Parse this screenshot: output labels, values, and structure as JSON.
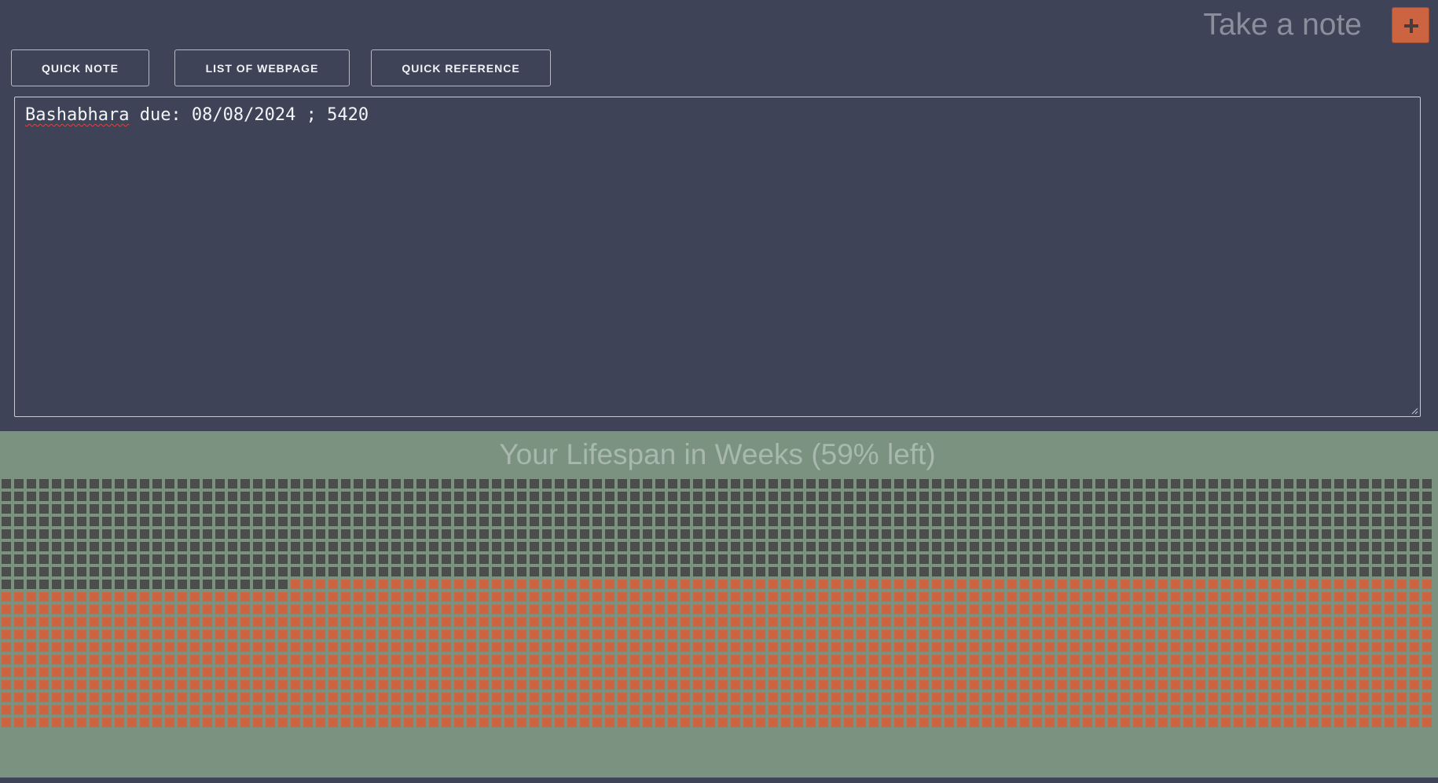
{
  "header": {
    "placeholder": "Take a note",
    "add_button_icon": "plus-icon"
  },
  "tabs": [
    {
      "label": "QUICK NOTE"
    },
    {
      "label": "LIST OF WEBPAGE"
    },
    {
      "label": "QUICK REFERENCE"
    }
  ],
  "note": {
    "misspelled_word": "Bashabhara",
    "rest": " due: 08/08/2024 ; 5420"
  },
  "lifespan": {
    "title": "Your Lifespan in Weeks (59% left)",
    "percent_left": 59,
    "colors": {
      "lived": "#4a4d4c",
      "left": "#cc6441",
      "background": "#7b9281",
      "accent": "#cc6441"
    }
  }
}
